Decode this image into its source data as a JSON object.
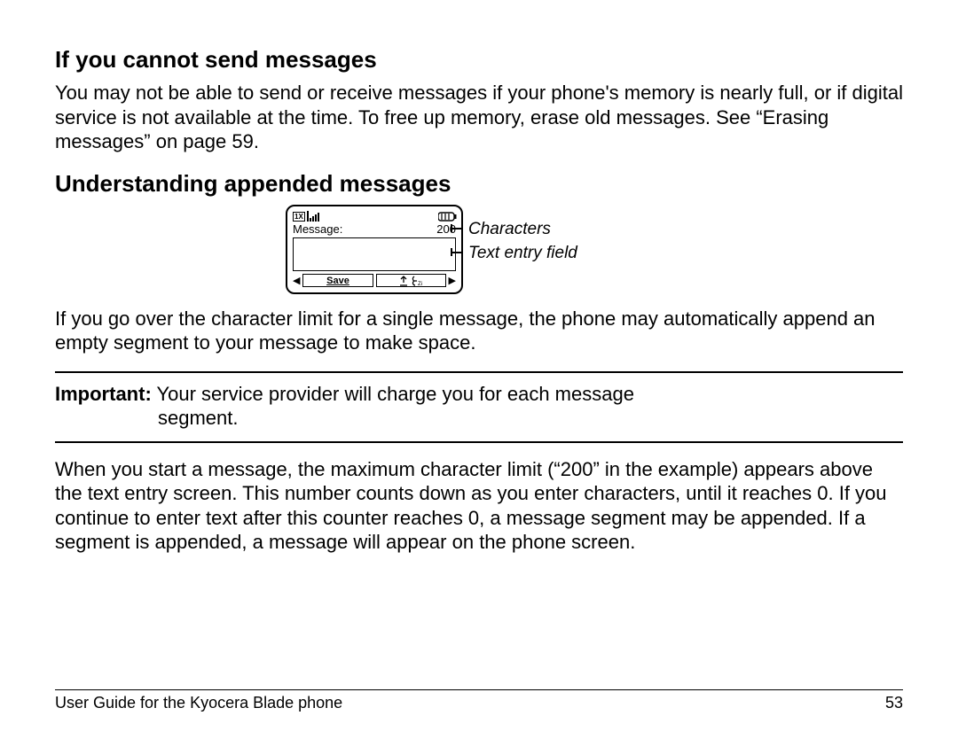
{
  "section1": {
    "heading": "If you cannot send messages",
    "para": "You may not be able to send or receive messages if your phone's memory is nearly full, or if digital service is not available at the time. To free up memory, erase old messages. See “Erasing messages” on page 59."
  },
  "section2": {
    "heading": "Understanding appended messages",
    "phone": {
      "network_badge": "1X",
      "msg_label": "Message:",
      "char_count": "200",
      "save_label": "Save"
    },
    "callouts": {
      "characters": "Characters",
      "text_field": "Text entry field"
    },
    "para_after_fig": "If you go over the character limit for a single message, the phone may automatically append an empty segment to your message to make space.",
    "important_label": "Important:",
    "important_text_line1": "Your service provider will charge you for each message",
    "important_text_line2": "segment.",
    "para2": "When you start a message, the maximum character limit (“200” in the example) appears above the text entry screen. This number counts down as you enter characters, until it reaches 0. If you continue to enter text after this counter reaches 0, a message segment may be appended. If a segment is appended, a message will appear on the phone screen."
  },
  "footer": {
    "title": "User Guide for the Kyocera Blade phone",
    "page": "53"
  }
}
